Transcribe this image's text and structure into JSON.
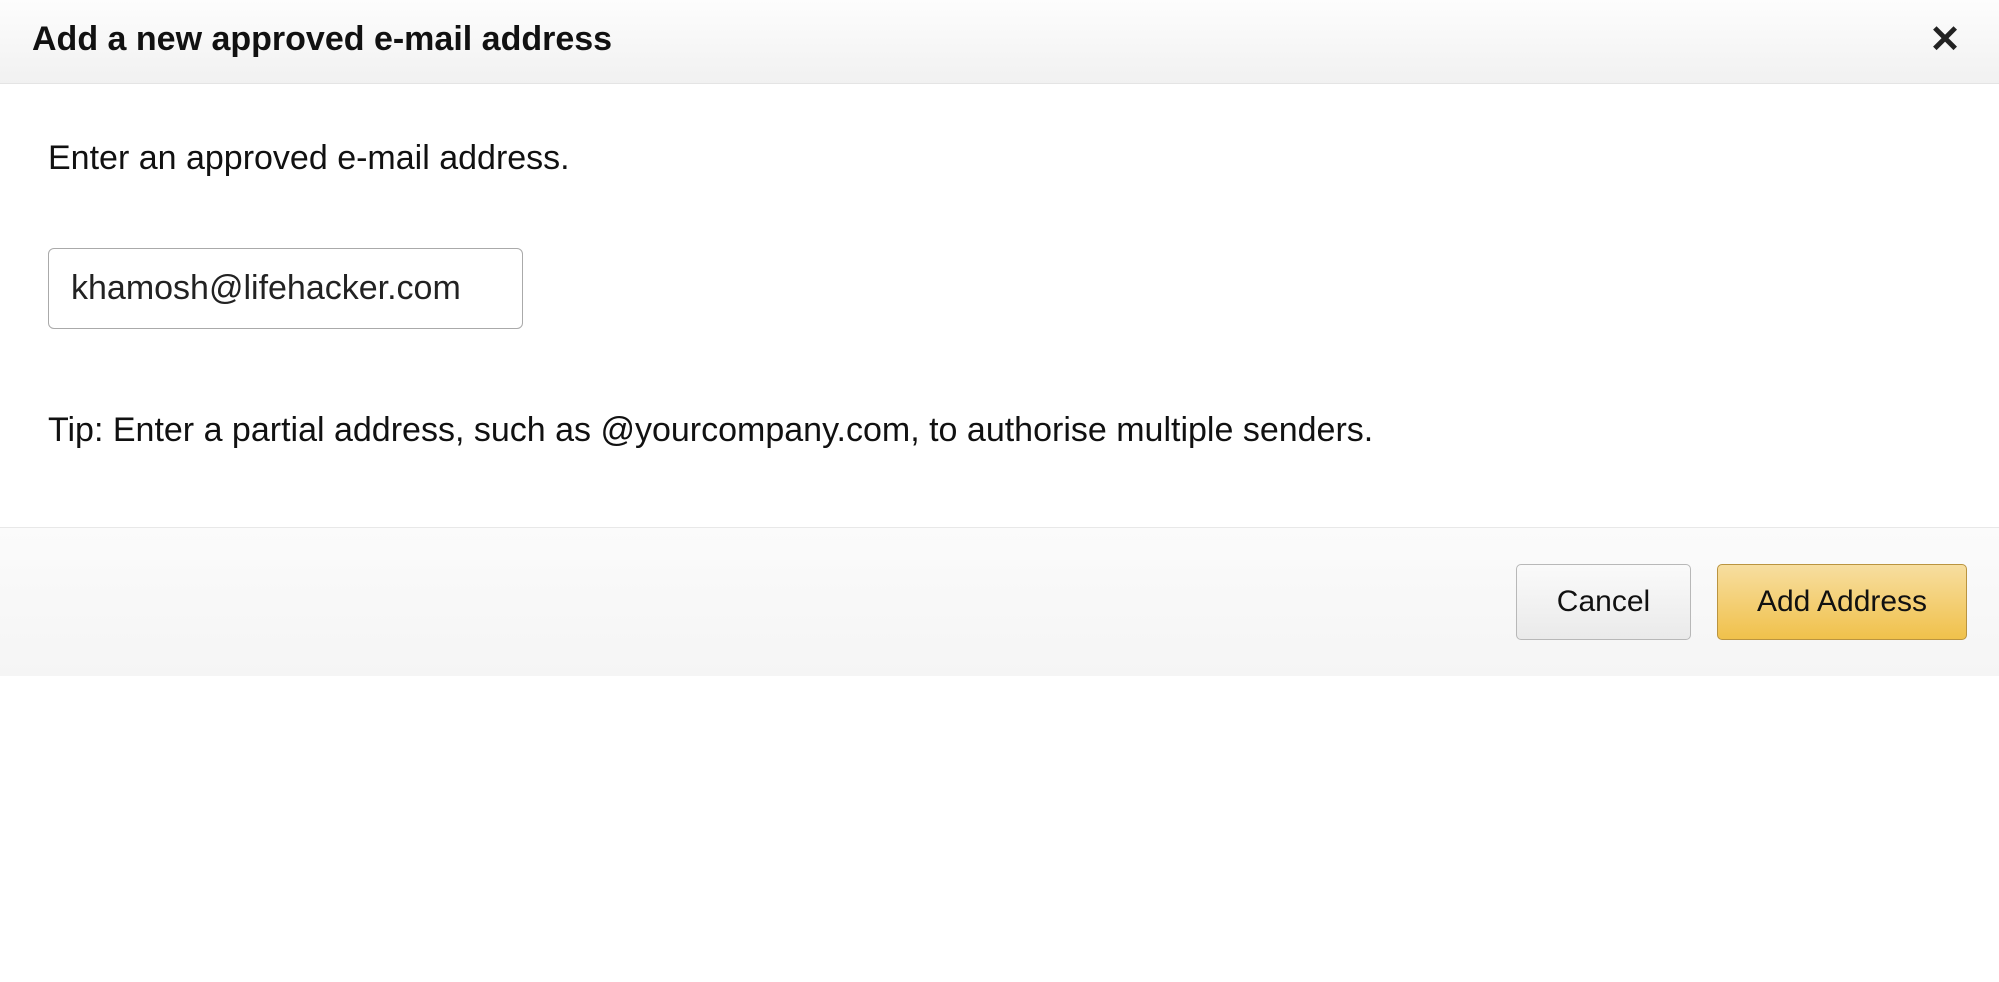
{
  "dialog": {
    "title": "Add a new approved e-mail address",
    "instruction": "Enter an approved e-mail address.",
    "input_value": "khamosh@lifehacker.com",
    "tip": "Tip: Enter a partial address, such as @yourcompany.com, to authorise multiple senders."
  },
  "buttons": {
    "cancel": "Cancel",
    "add_address": "Add Address"
  }
}
